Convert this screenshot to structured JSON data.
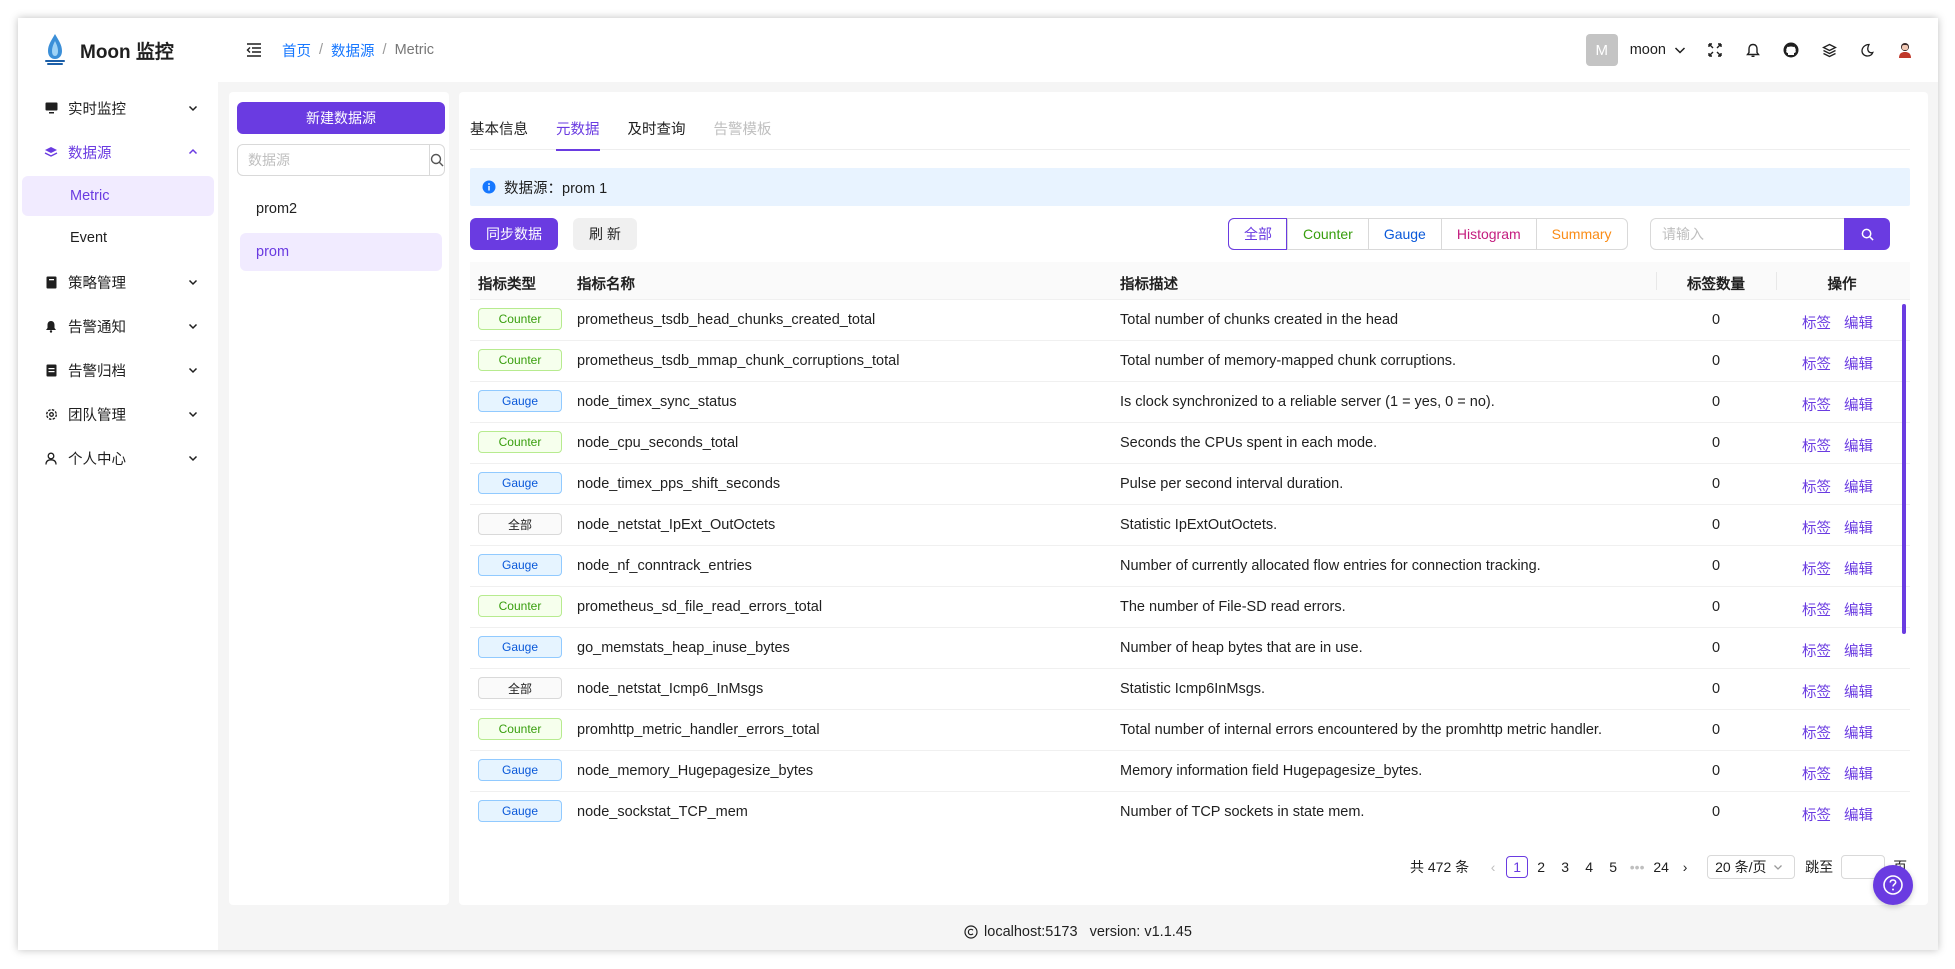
{
  "app": {
    "title": "Moon 监控"
  },
  "sidebar": {
    "items": [
      {
        "label": "实时监控",
        "icon": "monitor-icon"
      },
      {
        "label": "数据源",
        "icon": "layers-icon",
        "open": true,
        "children": [
          {
            "label": "Metric",
            "active": true
          },
          {
            "label": "Event"
          }
        ]
      },
      {
        "label": "策略管理",
        "icon": "book-icon"
      },
      {
        "label": "告警通知",
        "icon": "bell-icon"
      },
      {
        "label": "告警归档",
        "icon": "archive-icon"
      },
      {
        "label": "团队管理",
        "icon": "gear-icon"
      },
      {
        "label": "个人中心",
        "icon": "user-icon"
      }
    ]
  },
  "header": {
    "breadcrumb": [
      "首页",
      "数据源",
      "Metric"
    ],
    "avatar_letter": "M",
    "username": "moon"
  },
  "datasource_panel": {
    "new_button": "新建数据源",
    "search_placeholder": "数据源",
    "items": [
      {
        "label": "prom2"
      },
      {
        "label": "prom",
        "active": true
      }
    ]
  },
  "tabs": [
    {
      "label": "基本信息"
    },
    {
      "label": "元数据",
      "active": true
    },
    {
      "label": "及时查询"
    },
    {
      "label": "告警模板",
      "disabled": true
    }
  ],
  "alert": {
    "text": "数据源：prom 1"
  },
  "toolbar": {
    "sync_button": "同步数据",
    "refresh_button": "刷 新",
    "filters": [
      {
        "label": "全部",
        "color": "#6a3be1",
        "active": true
      },
      {
        "label": "Counter",
        "color": "#389e0d"
      },
      {
        "label": "Gauge",
        "color": "#0958d9"
      },
      {
        "label": "Histogram",
        "color": "#c41d7f"
      },
      {
        "label": "Summary",
        "color": "#fa8c16"
      }
    ],
    "search_placeholder": "请输入"
  },
  "table": {
    "columns": [
      "指标类型",
      "指标名称",
      "指标描述",
      "标签数量",
      "操作"
    ],
    "op_labels": {
      "labels": "标签",
      "edit": "编辑"
    },
    "rows": [
      {
        "type": "Counter",
        "name": "prometheus_tsdb_head_chunks_created_total",
        "desc": "Total number of chunks created in the head",
        "count": "0"
      },
      {
        "type": "Counter",
        "name": "prometheus_tsdb_mmap_chunk_corruptions_total",
        "desc": "Total number of memory-mapped chunk corruptions.",
        "count": "0"
      },
      {
        "type": "Gauge",
        "name": "node_timex_sync_status",
        "desc": "Is clock synchronized to a reliable server (1 = yes, 0 = no).",
        "count": "0"
      },
      {
        "type": "Counter",
        "name": "node_cpu_seconds_total",
        "desc": "Seconds the CPUs spent in each mode.",
        "count": "0"
      },
      {
        "type": "Gauge",
        "name": "node_timex_pps_shift_seconds",
        "desc": "Pulse per second interval duration.",
        "count": "0"
      },
      {
        "type": "全部",
        "name": "node_netstat_IpExt_OutOctets",
        "desc": "Statistic IpExtOutOctets.",
        "count": "0"
      },
      {
        "type": "Gauge",
        "name": "node_nf_conntrack_entries",
        "desc": "Number of currently allocated flow entries for connection tracking.",
        "count": "0"
      },
      {
        "type": "Counter",
        "name": "prometheus_sd_file_read_errors_total",
        "desc": "The number of File-SD read errors.",
        "count": "0"
      },
      {
        "type": "Gauge",
        "name": "go_memstats_heap_inuse_bytes",
        "desc": "Number of heap bytes that are in use.",
        "count": "0"
      },
      {
        "type": "全部",
        "name": "node_netstat_Icmp6_InMsgs",
        "desc": "Statistic Icmp6InMsgs.",
        "count": "0"
      },
      {
        "type": "Counter",
        "name": "promhttp_metric_handler_errors_total",
        "desc": "Total number of internal errors encountered by the promhttp metric handler.",
        "count": "0"
      },
      {
        "type": "Gauge",
        "name": "node_memory_Hugepagesize_bytes",
        "desc": "Memory information field Hugepagesize_bytes.",
        "count": "0"
      },
      {
        "type": "Gauge",
        "name": "node_sockstat_TCP_mem",
        "desc": "Number of TCP sockets in state mem.",
        "count": "0"
      }
    ]
  },
  "pagination": {
    "total_text": "共 472 条",
    "pages": [
      "1",
      "2",
      "3",
      "4",
      "5",
      "•••",
      "24"
    ],
    "current": "1",
    "page_size": "20 条/页",
    "jump_label": "跳至",
    "page_suffix": "页"
  },
  "footer": {
    "host": "localhost:5173",
    "version": "version: v1.1.45"
  }
}
